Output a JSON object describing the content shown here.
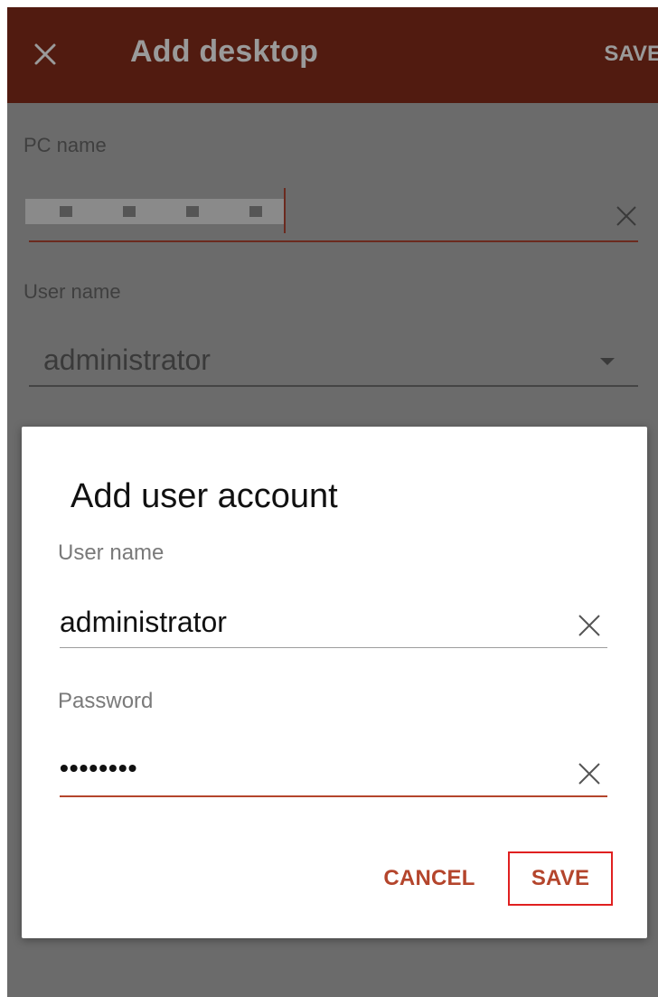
{
  "appbar": {
    "title": "Add desktop",
    "save_label": "SAVE",
    "close_icon": "close-icon",
    "color": "#511b10"
  },
  "form": {
    "pc_name_label": "PC name",
    "user_name_label": "User name",
    "user_name_value": "administrator"
  },
  "dialog": {
    "title": "Add user account",
    "user_name_label": "User name",
    "user_name_value": "administrator",
    "password_label": "Password",
    "password_value": "••••••••",
    "cancel_label": "CANCEL",
    "save_label": "SAVE",
    "accent_color": "#b4452c",
    "highlight_color": "#e02020"
  }
}
